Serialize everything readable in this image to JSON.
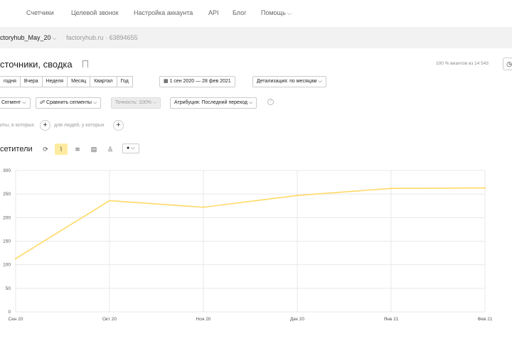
{
  "topnav": {
    "items": [
      "Счетчики",
      "Целевой звонок",
      "Настройка аккаунта",
      "API",
      "Блог",
      "Помощь"
    ]
  },
  "counter": {
    "name": "ctoryhub_May_20",
    "site": "factoryhub.ru",
    "id": "63894655"
  },
  "report": {
    "title": "сточники, сводка",
    "visits_note": "100 % визитов из 14 543"
  },
  "toolbar": {
    "periods": [
      "годня",
      "Вчера",
      "Неделя",
      "Месяц",
      "Квартал",
      "Год"
    ],
    "date_range": "1 сен 2020 — 28 фев 2021",
    "detail": "Детализация: по месяцам"
  },
  "segments": {
    "segment": "Сегмент",
    "compare": "Сравнить сегменты",
    "accuracy": "Точность: 100%",
    "attribution": "Атрибуция: Последний переход"
  },
  "filters": {
    "visits_text": "иты, в которых",
    "people_text": "для людей, у которых"
  },
  "chart_section": {
    "title": "сетители"
  },
  "colors": {
    "line": "#ffd966",
    "grid": "#e8e8e8",
    "active_bg": "#ffeba0"
  },
  "chart_data": {
    "type": "line",
    "categories": [
      "Сен 20",
      "Окт 20",
      "Ноя 20",
      "Дек 20",
      "Янв 21",
      "Фев 21"
    ],
    "series": [
      {
        "values": [
          113,
          236,
          222,
          247,
          262,
          263
        ]
      }
    ],
    "ylim": [
      0,
      300
    ],
    "yticks": [
      0,
      50,
      100,
      150,
      200,
      250,
      300
    ],
    "grid": true
  }
}
